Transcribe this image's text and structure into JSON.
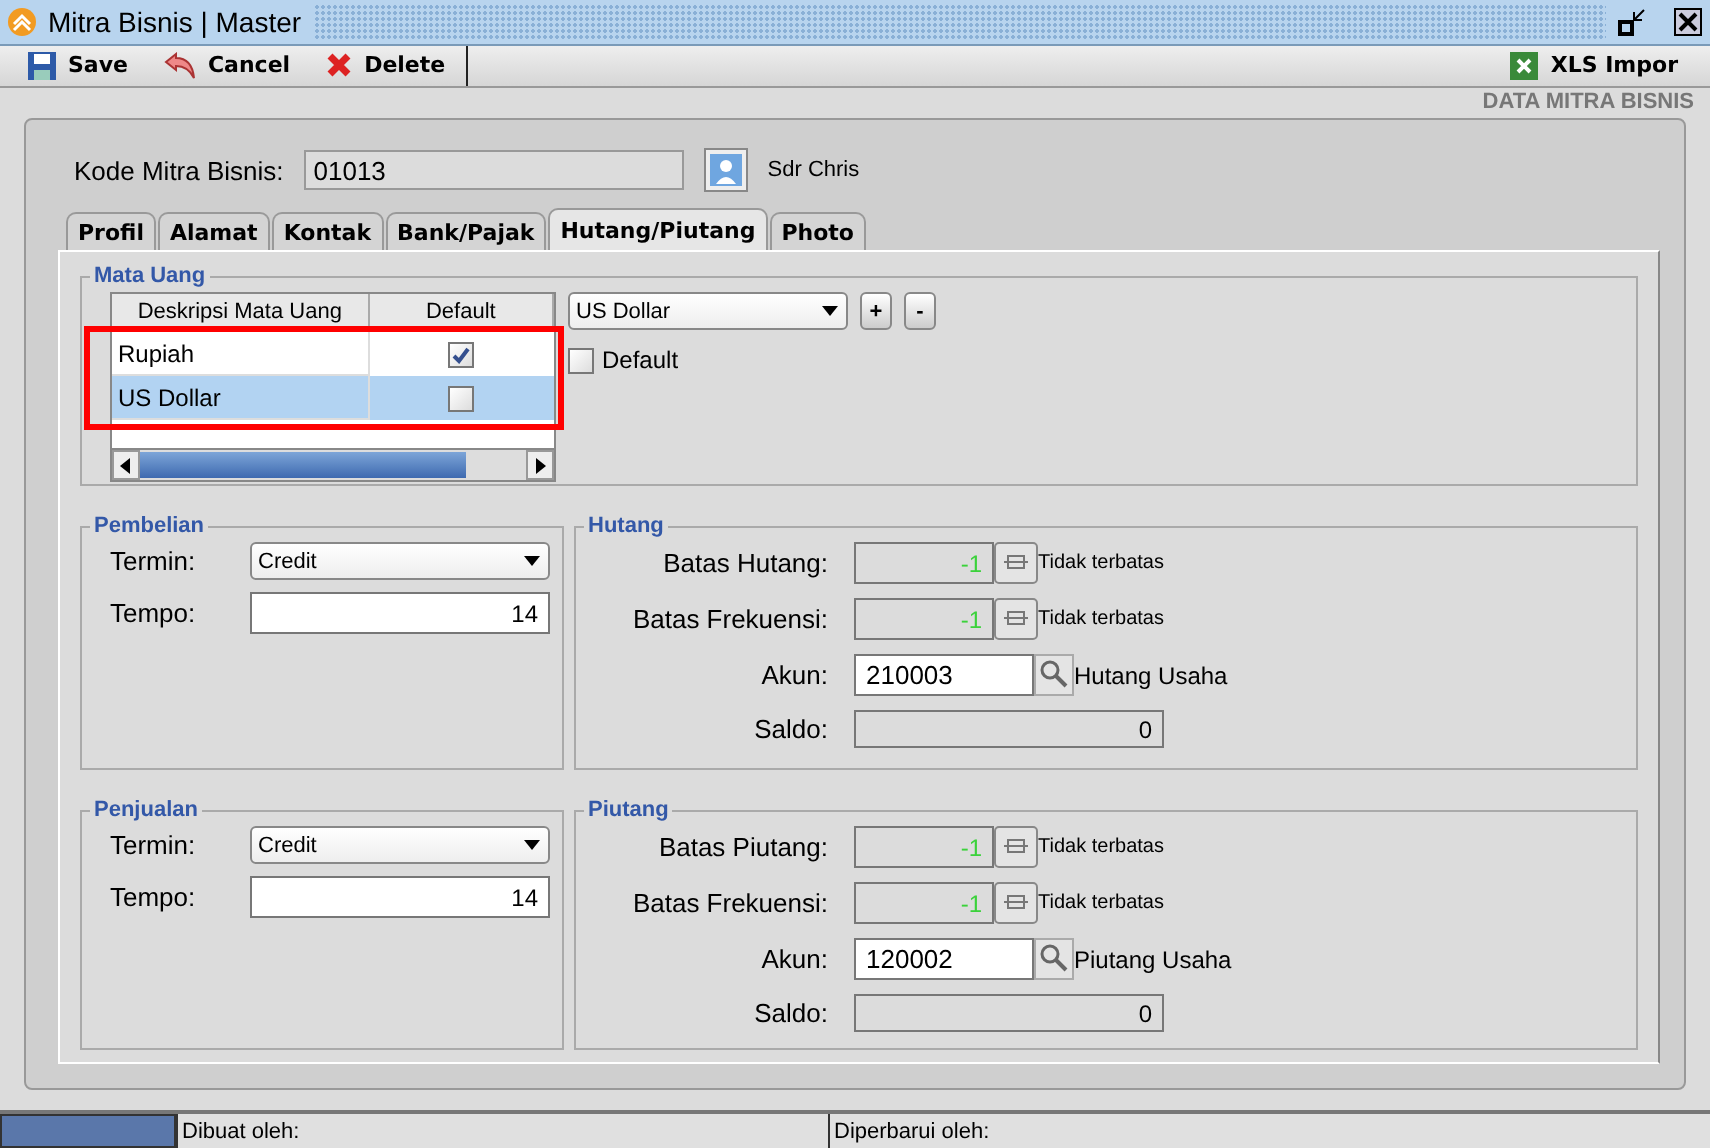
{
  "window": {
    "title": "Mitra Bisnis | Master"
  },
  "toolbar": [
    {
      "label": "Save",
      "kind": "save"
    },
    {
      "label": "Cancel",
      "kind": "cancel"
    },
    {
      "label": "Delete",
      "kind": "delete"
    }
  ],
  "import_button": "XLS Impor",
  "section_title": "DATA MITRA BISNIS",
  "code": {
    "label": "Kode Mitra Bisnis:",
    "value": "01013",
    "name": "Sdr Chris"
  },
  "tabs": [
    {
      "label": "Profil",
      "selected": false
    },
    {
      "label": "Alamat",
      "selected": false
    },
    {
      "label": "Kontak",
      "selected": false
    },
    {
      "label": "Bank/Pajak",
      "selected": false
    },
    {
      "label": "Hutang/Piutang",
      "selected": true
    },
    {
      "label": "Photo",
      "selected": false
    }
  ],
  "currency": {
    "title": "Mata Uang",
    "columns": [
      "Deskripsi Mata Uang",
      "Default"
    ],
    "rows": [
      {
        "name": "Rupiah",
        "default": true,
        "selected": false
      },
      {
        "name": "US Dollar",
        "default": false,
        "selected": true
      }
    ],
    "combo": "US Dollar",
    "add": "+",
    "remove": "-",
    "default_label": "Default",
    "default_checked": false
  },
  "terms": [
    {
      "title": "Pembelian",
      "termin_label": "Termin:",
      "termin": "Credit",
      "tempo_label": "Tempo:",
      "tempo": "14"
    },
    {
      "title": "Penjualan",
      "termin_label": "Termin:",
      "termin": "Credit",
      "tempo_label": "Tempo:",
      "tempo": "14"
    }
  ],
  "limits": [
    {
      "title": "Hutang",
      "rows": [
        {
          "kind": "limit",
          "label": "Batas Hutang:",
          "value": "-1",
          "note": "Tidak terbatas"
        },
        {
          "kind": "limit",
          "label": "Batas Frekuensi:",
          "value": "-1",
          "note": "Tidak terbatas"
        },
        {
          "kind": "account",
          "label": "Akun:",
          "value": "210003",
          "note": "Hutang Usaha"
        },
        {
          "kind": "balance",
          "label": "Saldo:",
          "value": "0"
        }
      ]
    },
    {
      "title": "Piutang",
      "rows": [
        {
          "kind": "limit",
          "label": "Batas Piutang:",
          "value": "-1",
          "note": "Tidak terbatas"
        },
        {
          "kind": "limit",
          "label": "Batas Frekuensi:",
          "value": "-1",
          "note": "Tidak terbatas"
        },
        {
          "kind": "account",
          "label": "Akun:",
          "value": "120002",
          "note": "Piutang Usaha"
        },
        {
          "kind": "balance",
          "label": "Saldo:",
          "value": "0"
        }
      ]
    }
  ],
  "status_bar": [
    {
      "label": "Dibuat oleh:"
    },
    {
      "label": "Diperbarui oleh:"
    }
  ]
}
